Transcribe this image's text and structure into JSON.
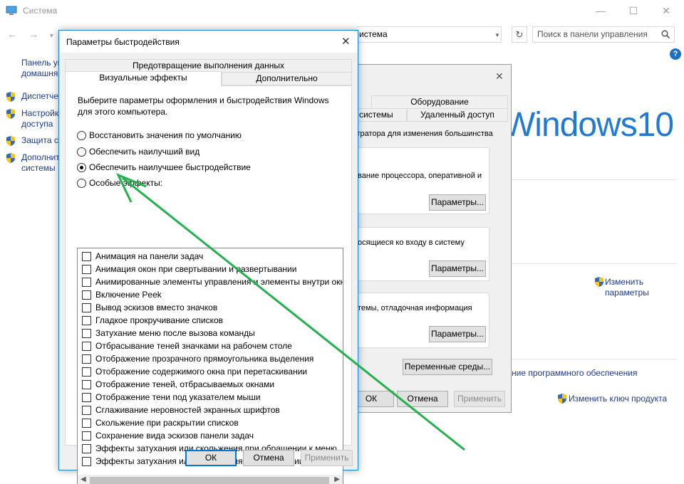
{
  "system_window": {
    "title": "Система",
    "address_text": "истема",
    "search_placeholder": "Поиск в панели управления",
    "sidebar": {
      "home": "Панель уп\nдомашняя",
      "items": [
        {
          "label": "Диспетчер"
        },
        {
          "label": "Настройк\nдоступа"
        },
        {
          "label": "Защита си"
        },
        {
          "label": "Дополнит\nсистемы"
        }
      ]
    },
    "logo_text": "Windows10",
    "links": {
      "change_params": "Изменить\nпараметры",
      "software": "ние программного обеспечения",
      "change_key": "Изменить ключ продукта"
    }
  },
  "system_properties": {
    "tabs_row1": [
      "",
      "Оборудование"
    ],
    "tabs_row2": [
      "системы",
      "Удаленный доступ"
    ],
    "header_text": "стратора для изменения большинства",
    "groups": [
      {
        "text": "вание процессора, оперативной и",
        "button": "Параметры..."
      },
      {
        "text": "осящиеся ко входу в систему",
        "button": "Параметры..."
      },
      {
        "text": "темы, отладочная информация",
        "button": "Параметры..."
      }
    ],
    "env_button": "Переменные среды...",
    "ok": "ОК",
    "cancel": "Отмена",
    "apply": "Применить"
  },
  "performance_dialog": {
    "title": "Параметры быстродействия",
    "tabs_top": [
      "Предотвращение выполнения данных"
    ],
    "tabs_bottom": [
      "Визуальные эффекты",
      "Дополнительно"
    ],
    "description": "Выберите параметры оформления и быстродействия Windows для этого компьютера.",
    "radios": [
      {
        "label": "Восстановить значения по умолчанию",
        "checked": false
      },
      {
        "label": "Обеспечить наилучший вид",
        "checked": false
      },
      {
        "label": "Обеспечить наилучшее быстродействие",
        "checked": true
      },
      {
        "label": "Особые эффекты:",
        "checked": false
      }
    ],
    "effects": [
      "Анимация на панели задач",
      "Анимация окон при свертывании и развертывании",
      "Анимированные элементы управления и элементы внутри окна",
      "Включение Peek",
      "Вывод эскизов вместо значков",
      "Гладкое прокручивание списков",
      "Затухание меню после вызова команды",
      "Отбрасывание теней значками на рабочем столе",
      "Отображение прозрачного прямоугольника выделения",
      "Отображение содержимого окна при перетаскивании",
      "Отображение теней, отбрасываемых окнами",
      "Отображение тени под указателем мыши",
      "Сглаживание неровностей экранных шрифтов",
      "Скольжение при раскрытии списков",
      "Сохранение вида эскизов панели задач",
      "Эффекты затухания или скольжения при обращении к меню",
      "Эффекты затухания или скольжения при появлении подсказок"
    ],
    "ok": "ОК",
    "cancel": "Отмена",
    "apply": "Применить"
  },
  "colors": {
    "accent": "#0078d7",
    "arrow": "#22b14c",
    "link": "#1e3b8e"
  }
}
